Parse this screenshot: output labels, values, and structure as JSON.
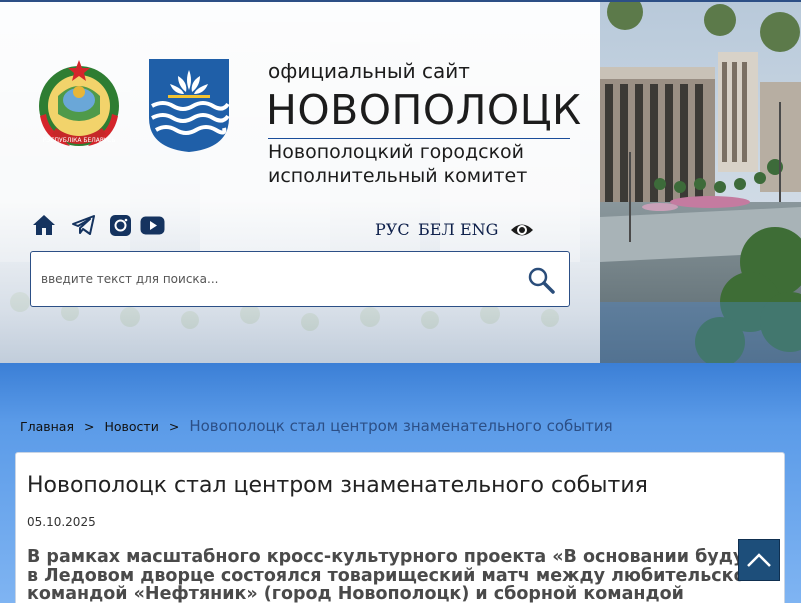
{
  "header": {
    "site_small": "официальный сайт",
    "city": "НОВОПОЛОЦК",
    "exec_line1": "Новополоцкий городской",
    "exec_line2": "исполнительный комитет",
    "emblem_ribbon": "РЭСПУБЛІКА БЕЛАРУСЬ"
  },
  "social": {
    "icons": [
      "home-icon",
      "telegram-icon",
      "instagram-icon",
      "youtube-icon"
    ]
  },
  "languages": [
    "РУС",
    "БЕЛ",
    "ENG"
  ],
  "accessibility_icon": "eye-icon",
  "search": {
    "placeholder": "введите текст для поиска..."
  },
  "breadcrumb": {
    "home": "Главная",
    "news": "Новости",
    "separator": ">",
    "current": "Новополоцк стал центром знаменательного события"
  },
  "article": {
    "title": "Новополоцк стал центром знаменательного события",
    "date": "05.10.2025",
    "lead_lines": [
      "В рамках масштабного кросс-культурного проекта «В основании будуще",
      "в Ледовом дворце состоялся товарищеский матч между любительской",
      "командой «Нефтяник» (город Новополоцк) и сборной командой"
    ]
  },
  "colors": {
    "brand_blue": "#2c4f86",
    "band_blue": "#5b9be8",
    "totop_bg": "#1d4e7a"
  },
  "totop_icon": "chevron-up-icon"
}
